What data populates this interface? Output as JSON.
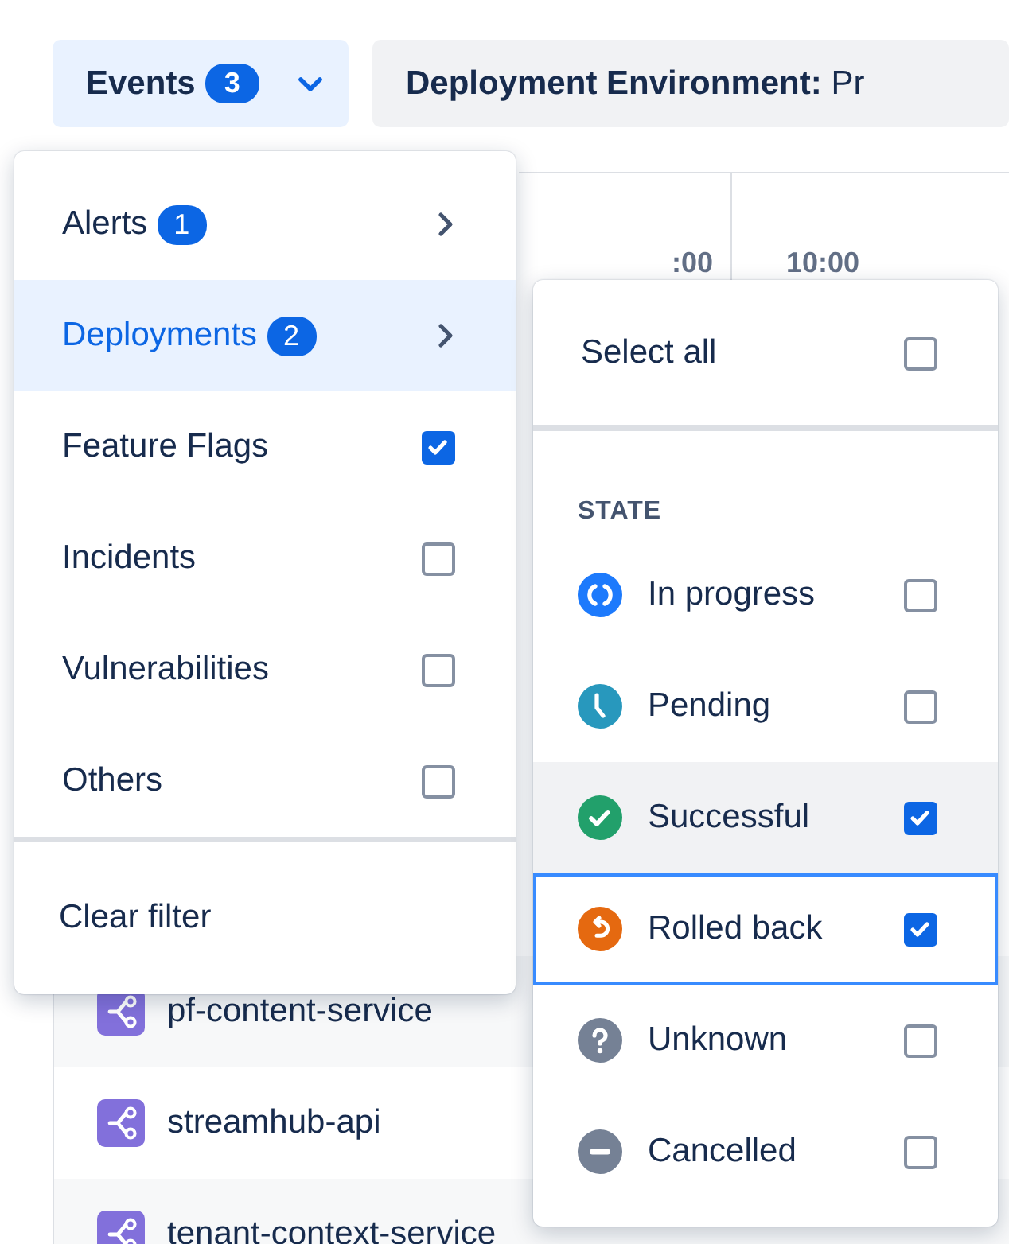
{
  "filter_bar": {
    "events_button": {
      "label": "Events",
      "count": "3",
      "open": true
    },
    "environment_button": {
      "label": "Deployment Environment:",
      "value": "Pr"
    }
  },
  "timeline": {
    "ticks": [
      ":00",
      "10:00"
    ]
  },
  "services": [
    {
      "name": "pf-content-service"
    },
    {
      "name": "streamhub-api"
    },
    {
      "name": "tenant-context-service"
    }
  ],
  "events_menu": {
    "items": [
      {
        "label": "Alerts",
        "kind": "submenu",
        "count": "1",
        "selected": false
      },
      {
        "label": "Deployments",
        "kind": "submenu",
        "count": "2",
        "selected": true
      },
      {
        "label": "Feature Flags",
        "kind": "checkbox",
        "checked": true,
        "selected": false
      },
      {
        "label": "Incidents",
        "kind": "checkbox",
        "checked": false,
        "selected": false
      },
      {
        "label": "Vulnerabilities",
        "kind": "checkbox",
        "checked": false,
        "selected": false
      },
      {
        "label": "Others",
        "kind": "checkbox",
        "checked": false,
        "selected": false
      }
    ],
    "clear_label": "Clear filter"
  },
  "deployments_submenu": {
    "select_all": {
      "label": "Select all",
      "checked": false
    },
    "section_title": "STATE",
    "states": [
      {
        "label": "In progress",
        "kind": "in_progress",
        "checked": false,
        "hovered": false,
        "focused": false
      },
      {
        "label": "Pending",
        "kind": "pending",
        "checked": false,
        "hovered": false,
        "focused": false
      },
      {
        "label": "Successful",
        "kind": "successful",
        "checked": true,
        "hovered": true,
        "focused": false
      },
      {
        "label": "Rolled back",
        "kind": "rolled_back",
        "checked": true,
        "hovered": false,
        "focused": true
      },
      {
        "label": "Unknown",
        "kind": "unknown",
        "checked": false,
        "hovered": false,
        "focused": false
      },
      {
        "label": "Cancelled",
        "kind": "cancelled",
        "checked": false,
        "hovered": false,
        "focused": false
      }
    ]
  }
}
